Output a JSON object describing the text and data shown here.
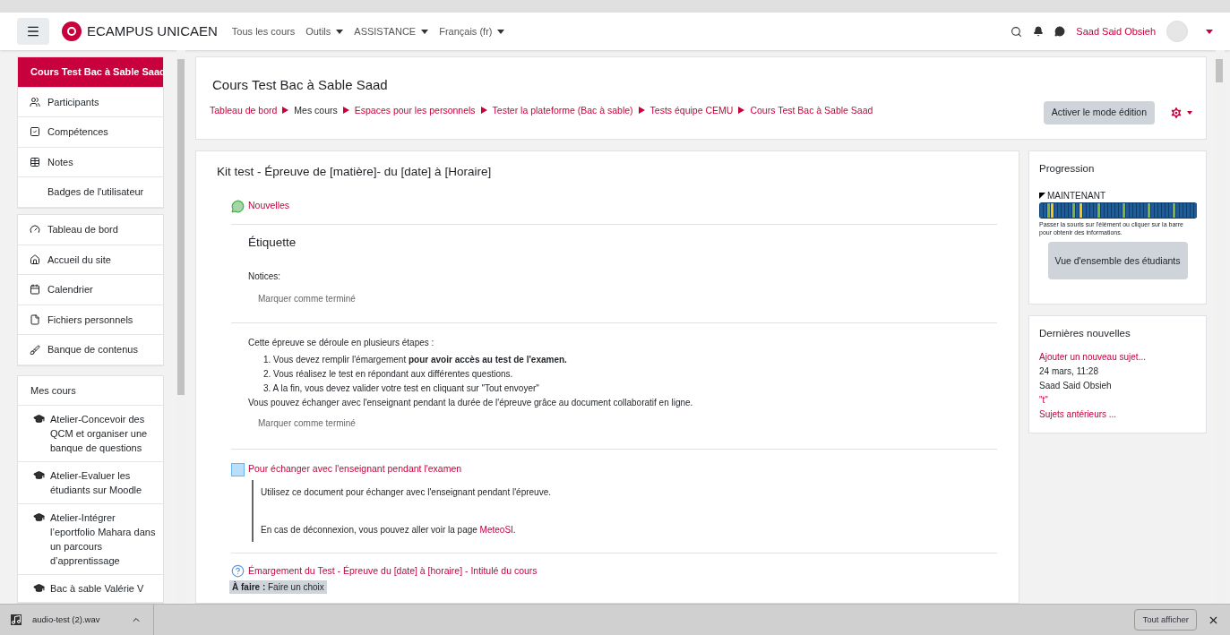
{
  "navbar": {
    "brand": "ECAMPUS UNICAEN",
    "menu": [
      {
        "label": "Tous les cours",
        "dropdown": false
      },
      {
        "label": "Outils",
        "dropdown": true
      },
      {
        "label": "ASSISTANCE",
        "dropdown": true
      },
      {
        "label": "Français (fr)",
        "dropdown": true
      }
    ],
    "user": "Saad Said Obsieh"
  },
  "sidebar": {
    "groups": [
      [
        {
          "label": "Cours Test Bac à Sable Saad",
          "selected": true
        },
        {
          "label": "Participants",
          "selected": false
        },
        {
          "label": "Compétences",
          "selected": false
        },
        {
          "label": "Notes",
          "selected": false
        },
        {
          "label": "Badges de l'utilisateur",
          "selected": false
        }
      ],
      [
        {
          "label": "Tableau de bord",
          "selected": false
        },
        {
          "label": "Accueil du site",
          "selected": false
        },
        {
          "label": "Calendrier",
          "selected": false
        },
        {
          "label": "Fichiers personnels",
          "selected": false
        },
        {
          "label": "Banque de contenus",
          "selected": false
        }
      ]
    ],
    "my_courses": {
      "title": "Mes cours",
      "items": [
        "Atelier-Concevoir des QCM et organiser une banque de questions",
        "Atelier-Evaluer les étudiants sur Moodle",
        "Atelier-Intégrer l’eportfolio Mahara dans un parcours d’apprentissage",
        "Bac à sable Valérie V"
      ]
    }
  },
  "header": {
    "title": "Cours Test Bac à Sable Saad",
    "breadcrumb": [
      {
        "label": "Tableau de bord",
        "kind": "link"
      },
      {
        "label": "Mes cours",
        "kind": "text"
      },
      {
        "label": "Espaces pour les personnels",
        "kind": "link"
      },
      {
        "label": "Tester la plateforme (Bac à sable)",
        "kind": "link"
      },
      {
        "label": "Tests équipe CEMU",
        "kind": "link"
      },
      {
        "label": "Cours Test Bac à Sable Saad",
        "kind": "link"
      }
    ],
    "edit_button": "Activer le mode édition"
  },
  "section": {
    "title": "Kit test - Épreuve de [matière]- du [date] à [Horaire]",
    "forum": "Nouvelles",
    "label1": {
      "heading": "Étiquette",
      "text": "Notices:",
      "complete": "Marquer comme terminé"
    },
    "label2": {
      "intro": "Cette épreuve se déroule en plusieurs étapes :",
      "steps": [
        "1. Vous devez remplir l'émargement **pour avoir accès au test de l'examen.**",
        "2. Vous réalisez le test en répondant aux différentes questions.",
        "3. A la fin, vous devez valider votre test en cliquant sur \"Tout envoyer\""
      ],
      "outro": "Vous pouvez échanger avec l'enseignant pendant la durée de l'épreuve grâce au document collaboratif en ligne.",
      "complete": "Marquer comme terminé"
    },
    "document": {
      "title": "Pour échanger avec l'enseignant pendant l'examen",
      "line1": "Utilisez ce document pour échanger avec l'enseignant pendant l'épreuve.",
      "line2": "En cas de déconnexion, vous pouvez aller voir la page",
      "link": "MeteoSI",
      "after": "."
    },
    "choice": {
      "title": "Émargement du Test - Épreuve du [date] à [horaire] - Intitulé du cours",
      "todo_label": "À faire :",
      "todo": "Faire un choix"
    }
  },
  "progress": {
    "title": "Progression",
    "now": "MAINTENANT",
    "hint": "Passer la souris sur l'élément ou cliquer sur la barre pour obtenir des informations.",
    "button": "Vue d'ensemble des étudiants"
  },
  "news": {
    "title": "Dernières nouvelles",
    "add": "Ajouter un nouveau sujet...",
    "date": "24 mars, 11:28",
    "author": "Saad Said Obsieh",
    "post": "\"t\"",
    "older": "Sujets antérieurs ..."
  },
  "download_bar": {
    "file": "audio-test (2).wav",
    "show_all": "Tout afficher"
  }
}
